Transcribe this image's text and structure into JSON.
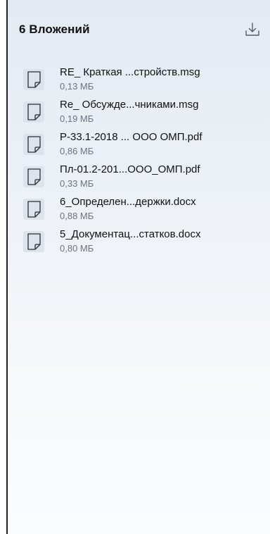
{
  "header": {
    "title": "6 Вложений",
    "download_icon": "download-icon"
  },
  "attachments": [
    {
      "name": "RE_ Краткая ...стройств.msg",
      "size": "0,13 МБ",
      "icon": "file-icon"
    },
    {
      "name": "Re_ Обсужде...чниками.msg",
      "size": "0,19 МБ",
      "icon": "file-icon"
    },
    {
      "name": "Р-33.1-2018 ... ООО ОМП.pdf",
      "size": "0,86 МБ",
      "icon": "file-icon"
    },
    {
      "name": "Пл-01.2-201...ООО_ОМП.pdf",
      "size": "0,33 МБ",
      "icon": "file-icon"
    },
    {
      "name": "6_Определен...держки.docx",
      "size": "0,88 МБ",
      "icon": "file-icon"
    },
    {
      "name": "5_Документац...статков.docx",
      "size": "0,80 МБ",
      "icon": "file-icon"
    }
  ]
}
